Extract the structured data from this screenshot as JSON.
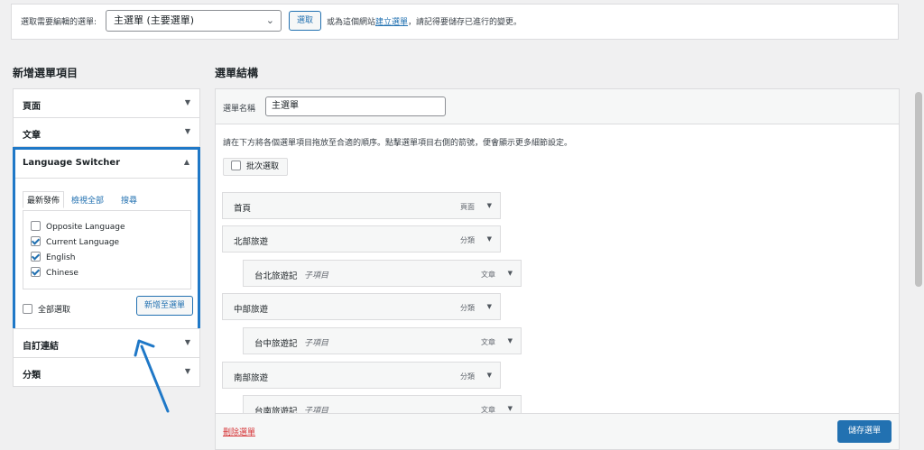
{
  "top_bar": {
    "label": "選取需要編輯的選單:",
    "menu_select_value": "主選單 (主要選單)",
    "select_button": "選取",
    "note_prefix": "或為這個網站",
    "note_link": "建立選單",
    "note_suffix": "，請記得要儲存已進行的變更。"
  },
  "left": {
    "title": "新增選單項目",
    "pages_label": "頁面",
    "posts_label": "文章",
    "language_switcher": {
      "title": "Language Switcher",
      "tabs": [
        "最新發佈",
        "檢視全部",
        "搜尋"
      ],
      "items": [
        {
          "label": "Opposite Language",
          "checked": false
        },
        {
          "label": "Current Language",
          "checked": true
        },
        {
          "label": "English",
          "checked": true
        },
        {
          "label": "Chinese",
          "checked": true
        }
      ],
      "select_all": "全部選取",
      "add_button": "新增至選單"
    },
    "custom_links_label": "自訂連結",
    "categories_label": "分類"
  },
  "right": {
    "title": "選單結構",
    "menu_name_label": "選單名稱",
    "menu_name_value": "主選單",
    "instructions": "請在下方將各個選單項目拖放至合適的順序。點擊選單項目右側的箭號，便會顯示更多細節設定。",
    "bulk_select": "批次選取",
    "items": [
      {
        "name": "首頁",
        "sub": "",
        "type": "頁面"
      },
      {
        "name": "北部旅遊",
        "sub": "",
        "type": "分類"
      },
      {
        "name": "台北旅遊記",
        "sub": "子項目",
        "type": "文章"
      },
      {
        "name": "中部旅遊",
        "sub": "",
        "type": "分類"
      },
      {
        "name": "台中旅遊記",
        "sub": "子項目",
        "type": "文章"
      },
      {
        "name": "南部旅遊",
        "sub": "",
        "type": "分類"
      },
      {
        "name": "台南旅遊記",
        "sub": "子項目",
        "type": "文章"
      }
    ],
    "delete_menu": "刪除選單",
    "save_menu": "儲存選單"
  },
  "icons": {
    "accordion_collapsed": "triangle-down-icon",
    "accordion_expanded": "triangle-up-icon",
    "annotation_arrow": "blue-arrow-annotation"
  },
  "colors": {
    "accent": "#2271b1",
    "highlight_border": "#1f78c7",
    "delete": "#d63638"
  }
}
